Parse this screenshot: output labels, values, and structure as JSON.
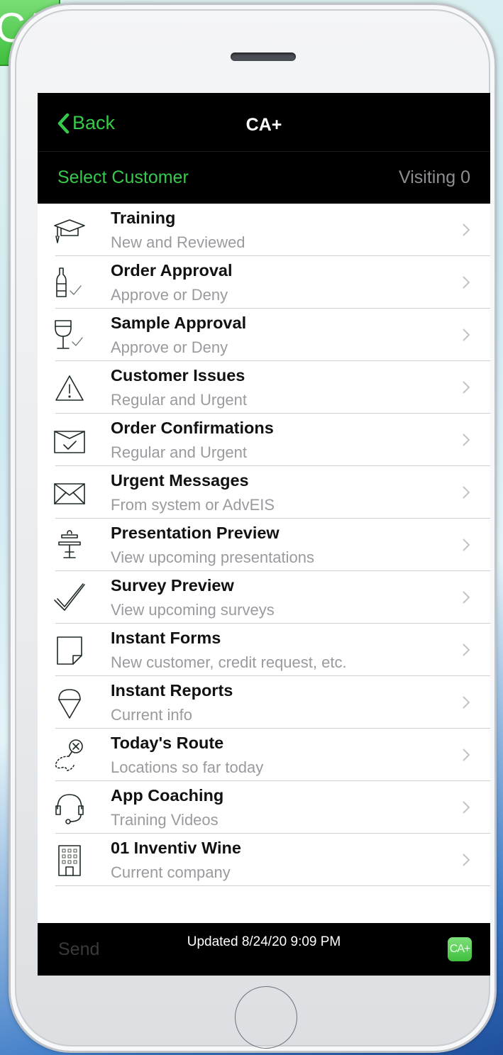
{
  "app": {
    "logo_text": "CA+"
  },
  "navbar": {
    "back_label": "Back",
    "title": "CA+"
  },
  "subbar": {
    "select_customer": "Select Customer",
    "visiting": "Visiting 0"
  },
  "menu": {
    "items": [
      {
        "title": "Training",
        "subtitle": "New and Reviewed",
        "icon": "graduation-cap-icon"
      },
      {
        "title": "Order Approval",
        "subtitle": "Approve or Deny",
        "icon": "bottle-check-icon"
      },
      {
        "title": "Sample Approval",
        "subtitle": "Approve or Deny",
        "icon": "wine-glass-check-icon"
      },
      {
        "title": "Customer Issues",
        "subtitle": "Regular and Urgent",
        "icon": "warning-icon"
      },
      {
        "title": "Order Confirmations",
        "subtitle": "Regular and Urgent",
        "icon": "box-check-icon"
      },
      {
        "title": "Urgent Messages",
        "subtitle": "From system or AdvEIS",
        "icon": "envelope-icon"
      },
      {
        "title": "Presentation Preview",
        "subtitle": "View upcoming presentations",
        "icon": "presentation-easel-icon"
      },
      {
        "title": "Survey Preview",
        "subtitle": "View upcoming surveys",
        "icon": "checkmark-icon"
      },
      {
        "title": "Instant Forms",
        "subtitle": "New customer, credit request, etc.",
        "icon": "form-note-icon"
      },
      {
        "title": "Instant Reports",
        "subtitle": "Current info",
        "icon": "ice-cream-cone-icon"
      },
      {
        "title": "Today's Route",
        "subtitle": "Locations so far today",
        "icon": "route-map-icon"
      },
      {
        "title": "App Coaching",
        "subtitle": "Training Videos",
        "icon": "headset-icon"
      },
      {
        "title": "01 Inventiv Wine",
        "subtitle": "Current company",
        "icon": "building-icon"
      }
    ]
  },
  "toolbar": {
    "send_label": "Send",
    "updated": "Updated 8/24/20 9:09 PM",
    "app_icon_text": "CA+"
  },
  "colors": {
    "accent_green": "#36c94b",
    "bar_black": "#000000",
    "secondary_gray": "#8e8e93"
  }
}
